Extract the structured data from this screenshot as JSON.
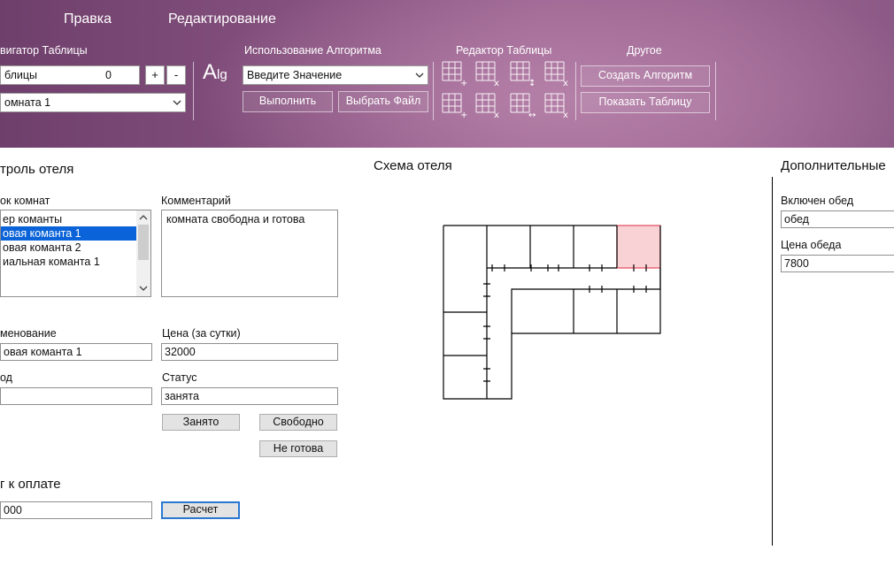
{
  "menu": {
    "item1": "Правка",
    "item2": "Редактирование"
  },
  "ribbon": {
    "navigator": {
      "title": "вигатор Таблицы",
      "table_label": "блицы",
      "table_value": "0",
      "plus": "+",
      "minus": "-",
      "room_select": "омната 1"
    },
    "algorithm": {
      "icon_text_big": "A",
      "icon_text_small": "lg",
      "title": "Использование Алгоритма",
      "select_placeholder": "Введите Значение",
      "run_button": "Выполнить",
      "file_button": "Выбрать Файл"
    },
    "table_editor": {
      "title": "Редактор Таблицы"
    },
    "other": {
      "title": "Другое",
      "create_button": "Создать Алгоритм",
      "show_button": "Показать Таблицу"
    }
  },
  "control": {
    "title": "троль отеля",
    "rooms_label": "ок комнат",
    "rooms": [
      "ер команты",
      "овая команта 1",
      "овая команта 2",
      "иальная команта 1"
    ],
    "selected_index": 1,
    "comment_label": "Комментарий",
    "comment_value": "комната свободна и готова",
    "name_label": "менование",
    "name_value": "овая команта 1",
    "price_label": "Цена (за сутки)",
    "price_value": "32000",
    "code_label": "од",
    "code_value": "",
    "status_label": "Статус",
    "status_value": "занята",
    "busy_button": "Занято",
    "free_button": "Свободно",
    "notready_button": "Не готова",
    "total_title": "г к оплате",
    "total_value": "000",
    "calc_button": "Расчет"
  },
  "scheme": {
    "title": "Схема отеля",
    "highlight_color": "#f9d2d6",
    "highlight_border": "#e24a5a"
  },
  "extra": {
    "title": "Дополнительные",
    "lunch_label": "Включен обед",
    "lunch_value": "обед",
    "lunch_price_label": "Цена обеда",
    "lunch_price_value": "7800"
  }
}
